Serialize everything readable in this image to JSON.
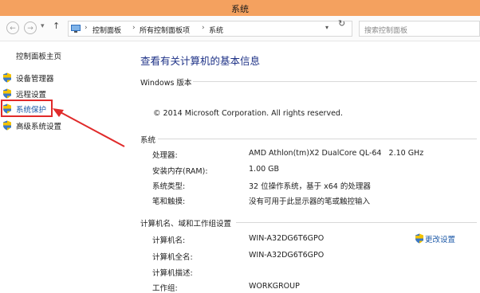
{
  "window": {
    "title": "系统"
  },
  "nav": {
    "back_icon": "←",
    "forward_icon": "→",
    "dropdown_icon": "▾",
    "up_icon": "↑",
    "breadcrumb_sep": "›",
    "breadcrumbs": [
      "控制面板",
      "所有控制面板项",
      "系统"
    ],
    "refresh_icon": "↻",
    "search_placeholder": "搜索控制面板"
  },
  "sidebar": {
    "home": "控制面板主页",
    "items": [
      {
        "label": "设备管理器",
        "icon": "shield-icon"
      },
      {
        "label": "远程设置",
        "icon": "shield-icon"
      },
      {
        "label": "系统保护",
        "icon": "shield-icon"
      },
      {
        "label": "高级系统设置",
        "icon": "shield-icon"
      }
    ]
  },
  "main": {
    "heading": "查看有关计算机的基本信息",
    "edition": {
      "title": "Windows 版本",
      "copyright": "© 2014 Microsoft Corporation. All rights reserved."
    },
    "system": {
      "title": "系统",
      "rows": [
        {
          "key": "处理器:",
          "value": "AMD Athlon(tm)X2 DualCore QL-64   2.10 GHz"
        },
        {
          "key": "安装内存(RAM):",
          "value": "1.00 GB"
        },
        {
          "key": "系统类型:",
          "value": "32 位操作系统，基于 x64 的处理器"
        },
        {
          "key": "笔和触摸:",
          "value": "没有可用于此显示器的笔或触控输入"
        }
      ]
    },
    "computer": {
      "title": "计算机名、域和工作组设置",
      "change_label": "更改设置",
      "rows": [
        {
          "key": "计算机名:",
          "value": "WIN-A32DG6T6GPO"
        },
        {
          "key": "计算机全名:",
          "value": "WIN-A32DG6T6GPO"
        },
        {
          "key": "计算机描述:",
          "value": ""
        },
        {
          "key": "工作组:",
          "value": "WORKGROUP"
        }
      ]
    }
  },
  "colors": {
    "titlebar": "#f4a15f",
    "heading": "#1e3287",
    "link": "#1e5aa8",
    "highlight": "#e02a2a"
  }
}
